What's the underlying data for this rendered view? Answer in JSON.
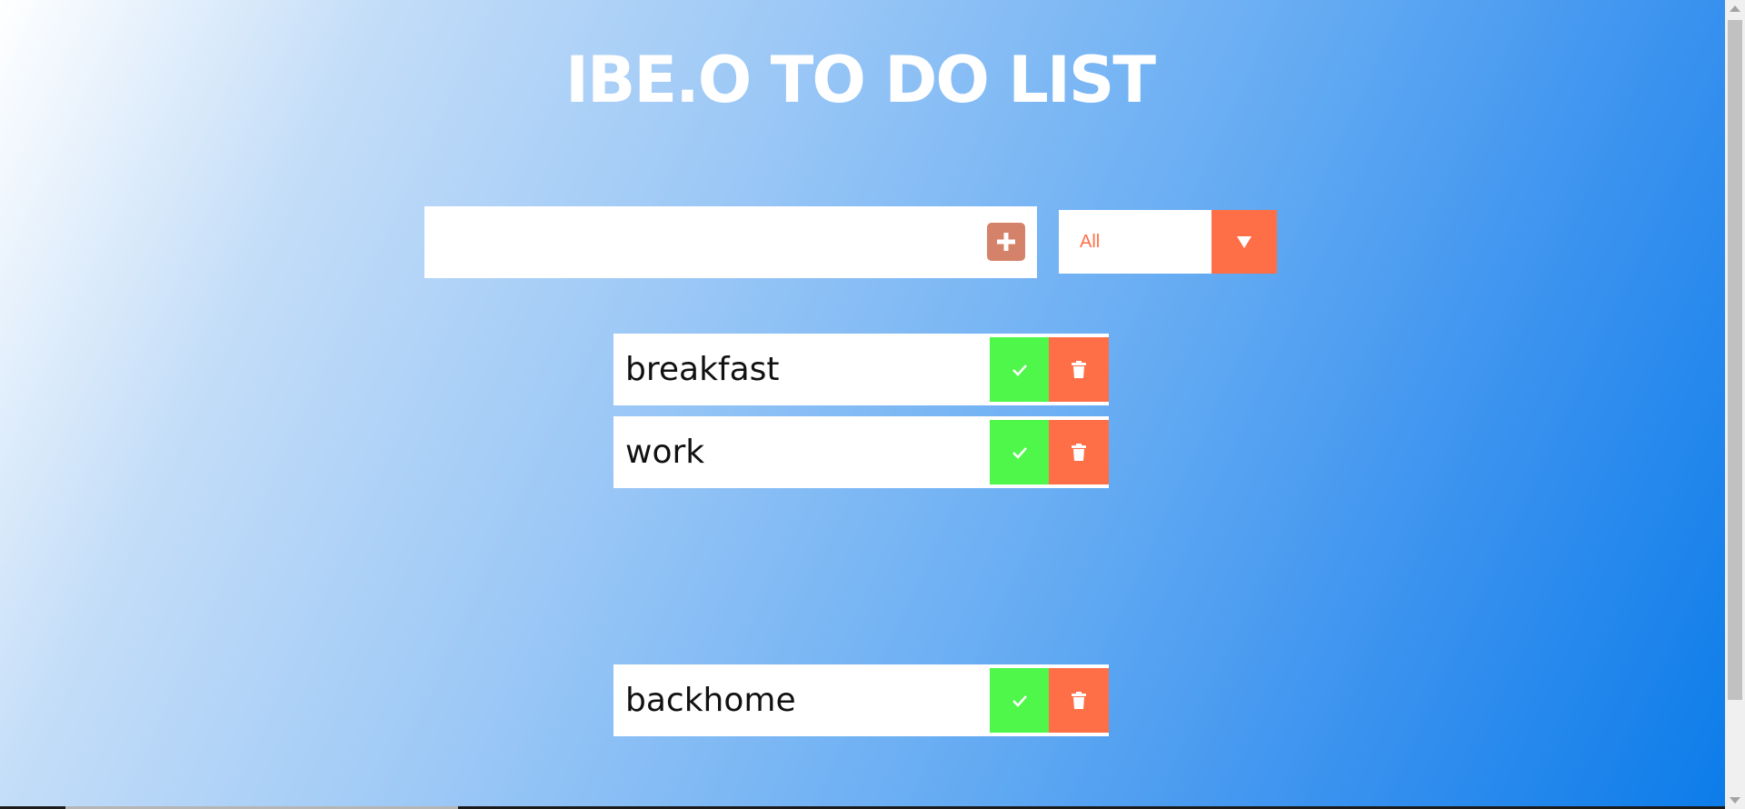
{
  "header": {
    "title": "IBE.O TO DO LIST"
  },
  "new_todo": {
    "value": "",
    "placeholder": ""
  },
  "add_button": {
    "icon": "plus-icon"
  },
  "filter": {
    "selected": "All",
    "icon": "dropdown-arrow-icon"
  },
  "todos": [
    {
      "text": "breakfast",
      "complete_icon": "check-icon",
      "delete_icon": "trash-icon"
    },
    {
      "text": "work",
      "complete_icon": "check-icon",
      "delete_icon": "trash-icon"
    },
    {
      "text": "backhome",
      "complete_icon": "check-icon",
      "delete_icon": "trash-icon"
    }
  ],
  "colors": {
    "title_text": "#ffffff",
    "add_button": "#d5826b",
    "accent": "#ff6f47",
    "complete": "#4ef74a",
    "item_background": "#ffffff"
  }
}
